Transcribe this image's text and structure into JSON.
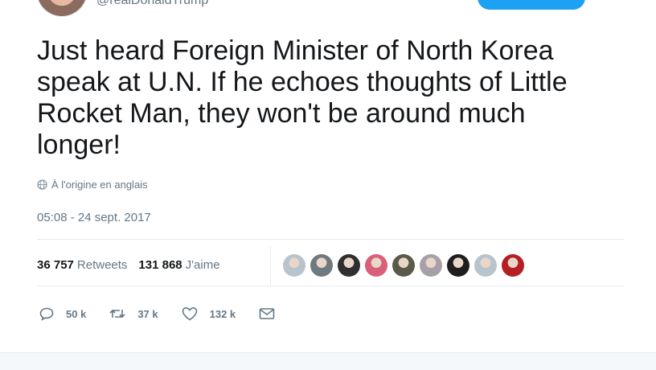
{
  "tweet": {
    "handle": "@realDonaldTrump",
    "text": "Just heard Foreign Minister of North Korea\nspeak at U.N. If he echoes thoughts of Little\nRocket Man, they won't be around much\nlonger!",
    "translation_note": "À l'origine en anglais",
    "timestamp": "05:08 - 24 sept. 2017"
  },
  "stats": {
    "retweets_count": "36 757",
    "retweets_label": "Retweets",
    "likes_count": "131 868",
    "likes_label": "J'aime"
  },
  "likers": [
    {
      "name": "liker-avatar-1",
      "color": "#b8c4cc"
    },
    {
      "name": "liker-avatar-2",
      "color": "#6f7a80"
    },
    {
      "name": "liker-avatar-3",
      "color": "#2f2f2f"
    },
    {
      "name": "liker-avatar-4",
      "color": "#d9607a"
    },
    {
      "name": "liker-avatar-5",
      "color": "#5a5a4a"
    },
    {
      "name": "liker-avatar-6",
      "color": "#a8a0a8"
    },
    {
      "name": "liker-avatar-7",
      "color": "#1e1e1e"
    },
    {
      "name": "liker-avatar-8",
      "color": "#b8c4cc"
    },
    {
      "name": "liker-avatar-9",
      "color": "#b51f24"
    }
  ],
  "actions": {
    "replies": "50 k",
    "retweets": "37 k",
    "likes": "132 k"
  },
  "icons": {
    "globe": "globe-icon",
    "reply": "reply-icon",
    "retweet": "retweet-icon",
    "like": "heart-icon",
    "dm": "envelope-icon"
  },
  "colors": {
    "accent": "#1da1f2",
    "muted": "#657786",
    "text": "#14171a",
    "divider": "#e6ecf0"
  }
}
